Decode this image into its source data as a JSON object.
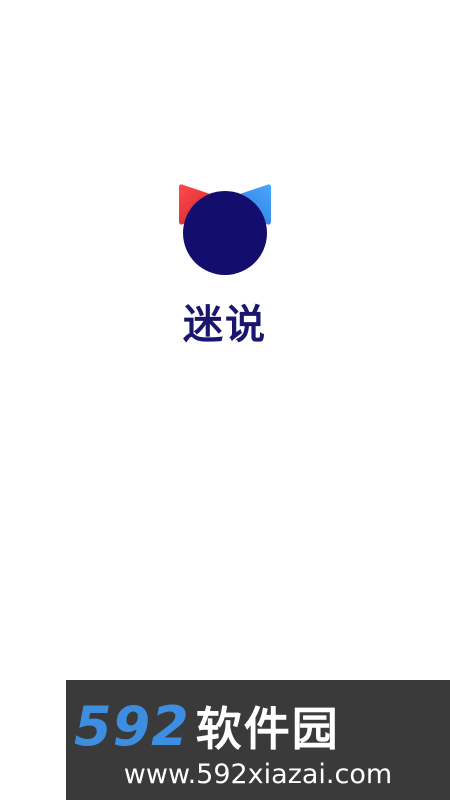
{
  "splash": {
    "app_name": "迷说",
    "logo_icon": "cat-head-logo-icon"
  },
  "watermark": {
    "brand_digits": "592",
    "brand_name": "软件园",
    "url": "www.592xiazai.com"
  },
  "colors": {
    "background": "#ffffff",
    "logo_dark": "#130d6e",
    "logo_red": "#e8383d",
    "logo_blue": "#3a8ee6",
    "app_name": "#1a1670",
    "watermark_bg": "#3a3a3a",
    "watermark_digits": "#3d8ee0"
  }
}
